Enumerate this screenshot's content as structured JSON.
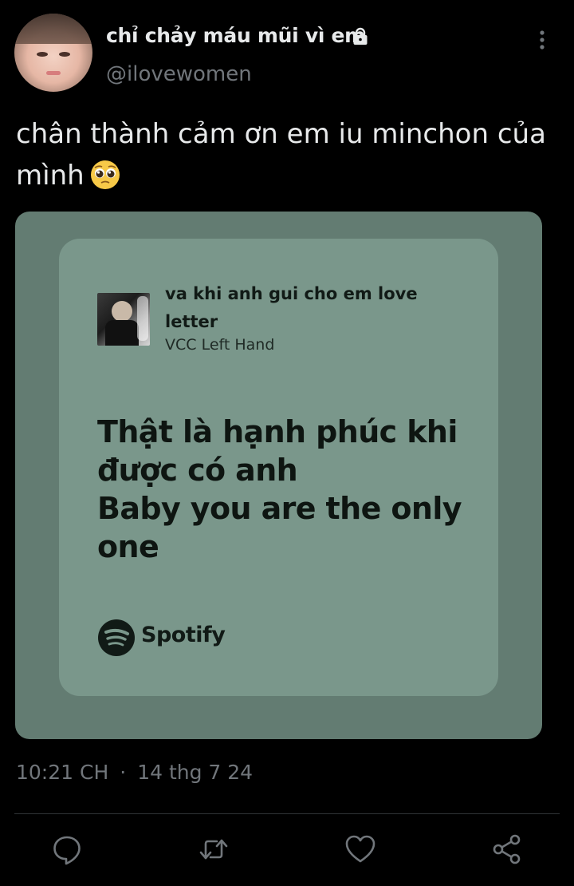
{
  "header": {
    "display_name": "chỉ chảy máu mũi vì em",
    "handle": "@ilovewomen",
    "protected_icon": "lock-icon",
    "menu_icon": "more-vertical-icon"
  },
  "tweet": {
    "text": "chân thành cảm ơn em iu minchon của mình",
    "emoji": "pleading-face-emoji"
  },
  "lyric_card": {
    "song_title": "va khi anh gui cho em love letter",
    "artist": "VCC Left Hand",
    "lyrics": [
      "Thật là hạnh phúc khi",
      "được có anh",
      "Baby you are the only",
      "one"
    ],
    "brand": "Spotify",
    "card_color": "#7a978b",
    "background_color": "#637c72"
  },
  "meta": {
    "time": "10:21 CH",
    "separator": "·",
    "date": "14 thg 7 24"
  },
  "actions": [
    "reply-icon",
    "retweet-icon",
    "like-icon",
    "share-icon"
  ],
  "colors": {
    "background": "#000000",
    "text": "#e7e9ea",
    "secondary_text": "#71767b"
  }
}
